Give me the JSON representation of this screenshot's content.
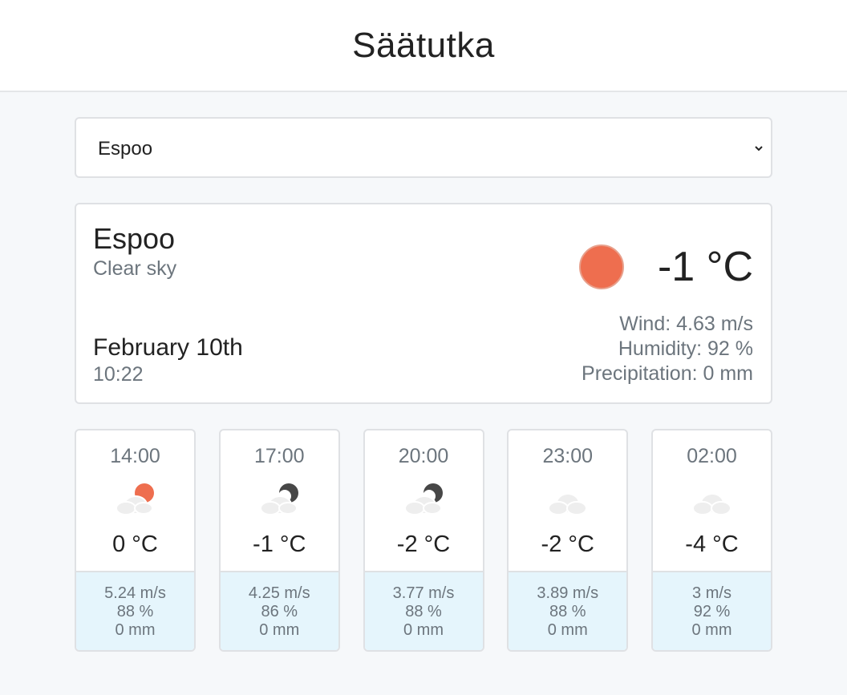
{
  "header": {
    "title": "Säätutka"
  },
  "city_select": {
    "selected": "Espoo"
  },
  "current": {
    "city": "Espoo",
    "description": "Clear sky",
    "date": "February 10th",
    "time": "10:22",
    "temperature": "-1 °C",
    "icon": "sun-icon",
    "wind": "Wind: 4.63 m/s",
    "humidity": "Humidity: 92 %",
    "precipitation": "Precipitation: 0 mm"
  },
  "forecast": [
    {
      "time": "14:00",
      "icon": "cloud-sun-icon",
      "temp": "0 °C",
      "wind": "5.24 m/s",
      "humidity": "88 %",
      "precip": "0 mm"
    },
    {
      "time": "17:00",
      "icon": "cloud-moon-icon",
      "temp": "-1 °C",
      "wind": "4.25 m/s",
      "humidity": "86 %",
      "precip": "0 mm"
    },
    {
      "time": "20:00",
      "icon": "cloud-moon-icon",
      "temp": "-2 °C",
      "wind": "3.77 m/s",
      "humidity": "88 %",
      "precip": "0 mm"
    },
    {
      "time": "23:00",
      "icon": "cloud-icon",
      "temp": "-2 °C",
      "wind": "3.89 m/s",
      "humidity": "88 %",
      "precip": "0 mm"
    },
    {
      "time": "02:00",
      "icon": "cloud-icon",
      "temp": "-4 °C",
      "wind": "3 m/s",
      "humidity": "92 %",
      "precip": "0 mm"
    }
  ],
  "colors": {
    "sun": "#ee6e4f",
    "moon": "#474747",
    "cloud": "#eeeeee",
    "detail_bg": "#e5f5fc"
  }
}
